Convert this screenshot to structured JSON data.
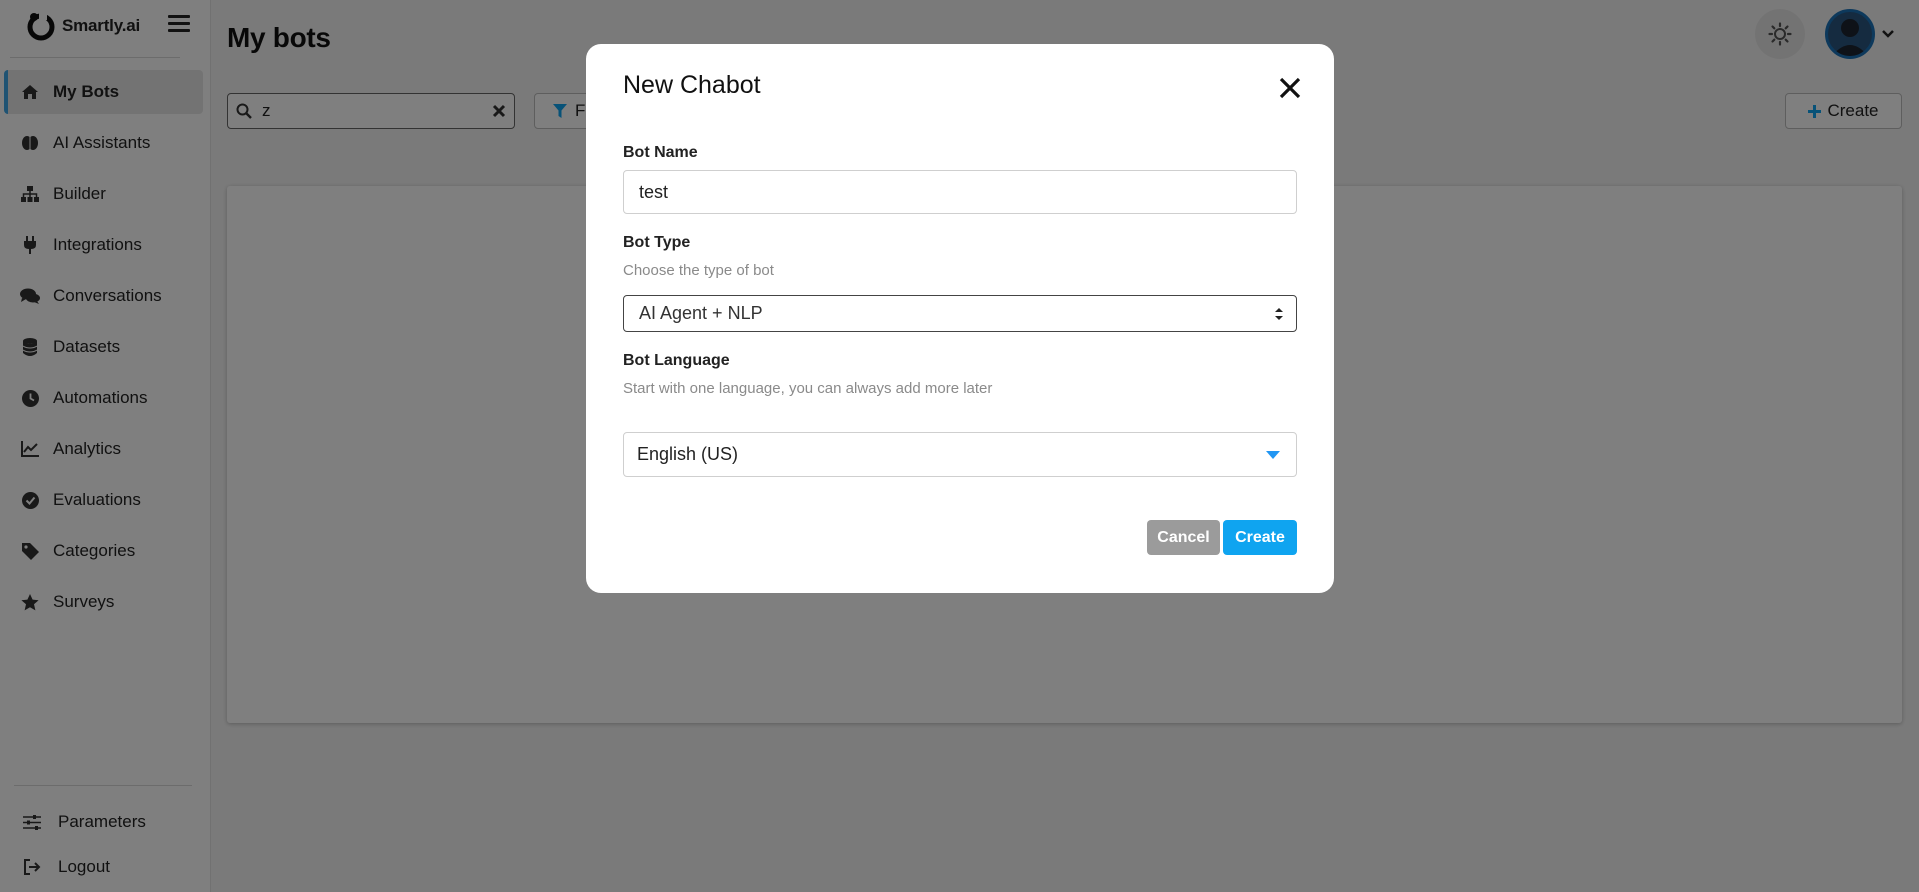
{
  "app": {
    "brand_name": "Smartly.ai"
  },
  "sidebar": {
    "items": [
      {
        "label": "My Bots",
        "icon": "home-icon",
        "active": true
      },
      {
        "label": "AI Assistants",
        "icon": "brain-icon"
      },
      {
        "label": "Builder",
        "icon": "sitemap-icon"
      },
      {
        "label": "Integrations",
        "icon": "plug-icon"
      },
      {
        "label": "Conversations",
        "icon": "comments-icon"
      },
      {
        "label": "Datasets",
        "icon": "database-icon"
      },
      {
        "label": "Automations",
        "icon": "clock-icon"
      },
      {
        "label": "Analytics",
        "icon": "line-chart-icon"
      },
      {
        "label": "Evaluations",
        "icon": "check-circle-icon"
      },
      {
        "label": "Categories",
        "icon": "tag-icon"
      },
      {
        "label": "Surveys",
        "icon": "star-icon"
      }
    ],
    "footer": [
      {
        "label": "Parameters",
        "icon": "sliders-icon"
      },
      {
        "label": "Logout",
        "icon": "sign-out-icon"
      }
    ]
  },
  "main": {
    "title": "My bots",
    "search_value": "z",
    "filter_label": "F",
    "create_label": "Create"
  },
  "modal": {
    "title": "New Chabot",
    "bot_name_label": "Bot Name",
    "bot_name_value": "test",
    "bot_type_label": "Bot Type",
    "bot_type_hint": "Choose the type of bot",
    "bot_type_value": "AI Agent + NLP",
    "bot_language_label": "Bot Language",
    "bot_language_hint": "Start with one language, you can always add more later",
    "bot_language_value": "English (US)",
    "cancel_label": "Cancel",
    "create_label": "Create"
  },
  "colors": {
    "accent": "#0fa4f0",
    "active_indicator": "#3fa7e6",
    "cancel_button": "#9b9b9b",
    "overlay": "rgba(0,0,0,0.5)"
  }
}
